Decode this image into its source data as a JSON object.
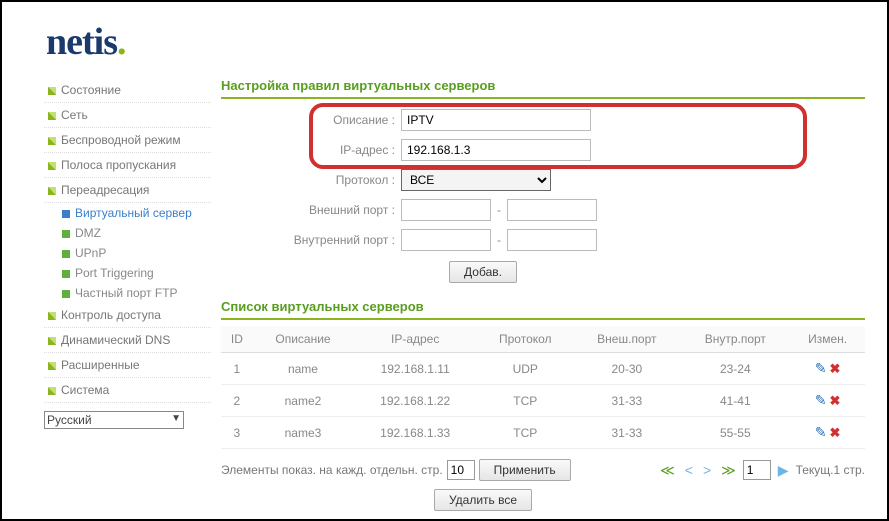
{
  "logo": {
    "text": "netis"
  },
  "sidebar": {
    "items": [
      {
        "label": "Состояние",
        "kind": "top"
      },
      {
        "label": "Сеть",
        "kind": "top"
      },
      {
        "label": "Беспроводной режим",
        "kind": "top"
      },
      {
        "label": "Полоса пропускания",
        "kind": "top"
      },
      {
        "label": "Переадресация",
        "kind": "top"
      },
      {
        "label": "Виртуальный сервер",
        "kind": "sub-active"
      },
      {
        "label": "DMZ",
        "kind": "sub"
      },
      {
        "label": "UPnP",
        "kind": "sub"
      },
      {
        "label": "Port Triggering",
        "kind": "sub"
      },
      {
        "label": "Частный порт FTP",
        "kind": "sub"
      },
      {
        "label": "Контроль доступа",
        "kind": "top"
      },
      {
        "label": "Динамический DNS",
        "kind": "top"
      },
      {
        "label": "Расширенные",
        "kind": "top"
      },
      {
        "label": "Система",
        "kind": "top"
      }
    ],
    "language": "Русский"
  },
  "form": {
    "title": "Настройка правил виртуальных серверов",
    "labels": {
      "descr": "Описание :",
      "ip": "IP-адрес :",
      "proto": "Протокол :",
      "ext_port": "Внешний порт :",
      "int_port": "Внутренний порт :"
    },
    "values": {
      "descr": "IPTV",
      "ip": "192.168.1.3",
      "proto": "ВСЕ",
      "ext_from": "",
      "ext_to": "",
      "int_from": "",
      "int_to": ""
    },
    "add_btn": "Добав."
  },
  "list": {
    "title": "Список виртуальных серверов",
    "headers": {
      "id": "ID",
      "descr": "Описание",
      "ip": "IP-адрес",
      "proto": "Протокол",
      "ext": "Внеш.порт",
      "int": "Внутр.порт",
      "act": "Измен."
    },
    "rows": [
      {
        "id": "1",
        "descr": "name",
        "ip": "192.168.1.11",
        "proto": "UDP",
        "ext": "20-30",
        "int": "23-24"
      },
      {
        "id": "2",
        "descr": "name2",
        "ip": "192.168.1.22",
        "proto": "TCP",
        "ext": "31-33",
        "int": "41-41"
      },
      {
        "id": "3",
        "descr": "name3",
        "ip": "192.168.1.33",
        "proto": "TCP",
        "ext": "31-33",
        "int": "55-55"
      }
    ]
  },
  "pager": {
    "label": "Элементы показ. на кажд. отдельн. стр.",
    "per_page": "10",
    "apply": "Применить",
    "page": "1",
    "current": "Текущ.1 стр.",
    "delete_all": "Удалить все"
  }
}
